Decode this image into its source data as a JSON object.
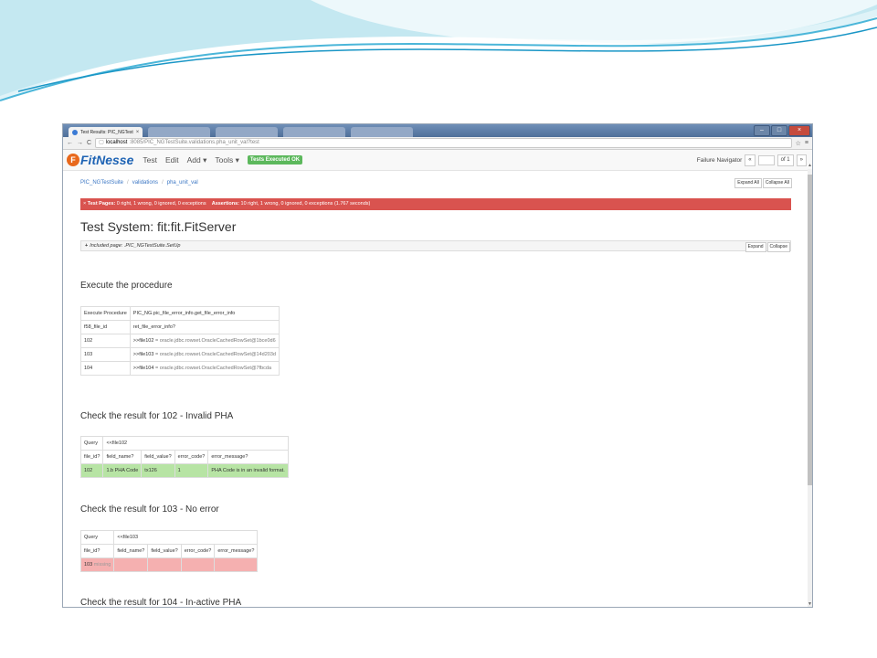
{
  "browser": {
    "tab_title": "Test Results: PIC_NGTest",
    "url_host": "localhost",
    "url_path": ":8085/PIC_NGTestSuite.validations.pha_unit_val?test"
  },
  "navbar": {
    "logo_text": "FitNesse",
    "items": [
      "Test",
      "Edit",
      "Add ▾",
      "Tools ▾"
    ],
    "status_label": "Tests Executed OK",
    "failure_navigator_label": "Failure Navigator",
    "prev_label": "«",
    "next_label": "»",
    "page_of": "of 1"
  },
  "breadcrumb": [
    "PIC_NGTestSuite",
    "validations",
    "pha_unit_val"
  ],
  "toolbar": {
    "expand_all": "Expand All",
    "collapse_all": "Collapse All"
  },
  "summary": {
    "test_pages_label": "Test Pages:",
    "test_pages_value": "0 right, 1 wrong, 0 ignored, 0 exceptions",
    "assertions_label": "Assertions:",
    "assertions_value": "10 right, 1 wrong, 0 ignored, 0 exceptions (1.767 seconds)"
  },
  "system_title": "Test System: fit:fit.FitServer",
  "included": {
    "text": "Included page: .PIC_NGTestSuite.SetUp",
    "expand": "Expand",
    "collapse": "Collapse"
  },
  "sections": {
    "execute": {
      "title": "Execute the procedure",
      "rows": [
        [
          "Execute Procedure",
          "PIC_NG.pic_file_error_info.get_file_error_info"
        ],
        [
          "f58_file_id",
          "ret_file_error_info?"
        ],
        [
          "102",
          ">>file102",
          " = oracle.jdbc.rowset.OracleCachedRowSet@1bce0d6"
        ],
        [
          "103",
          ">>file103",
          " = oracle.jdbc.rowset.OracleCachedRowSet@14d203d"
        ],
        [
          "104",
          ">>file104",
          " = oracle.jdbc.rowset.OracleCachedRowSet@7fbcda"
        ]
      ]
    },
    "check102": {
      "title": "Check the result for 102 - Invalid PHA",
      "query": [
        "Query",
        "<<file102"
      ],
      "headers": [
        "file_id?",
        "field_name?",
        "field_value?",
        "error_code?",
        "error_message?"
      ],
      "row": [
        "102",
        "1.b PHA Code",
        "tx126",
        "1",
        "PHA Code is in an invalid format."
      ]
    },
    "check103": {
      "title": "Check the result for 103 - No error",
      "query": [
        "Query",
        "<<file103"
      ],
      "headers": [
        "file_id?",
        "field_name?",
        "field_value?",
        "error_code?",
        "error_message?"
      ],
      "row_id": "103",
      "row_missing": "missing"
    },
    "check104": {
      "title": "Check the result for 104 - In-active PHA"
    }
  }
}
